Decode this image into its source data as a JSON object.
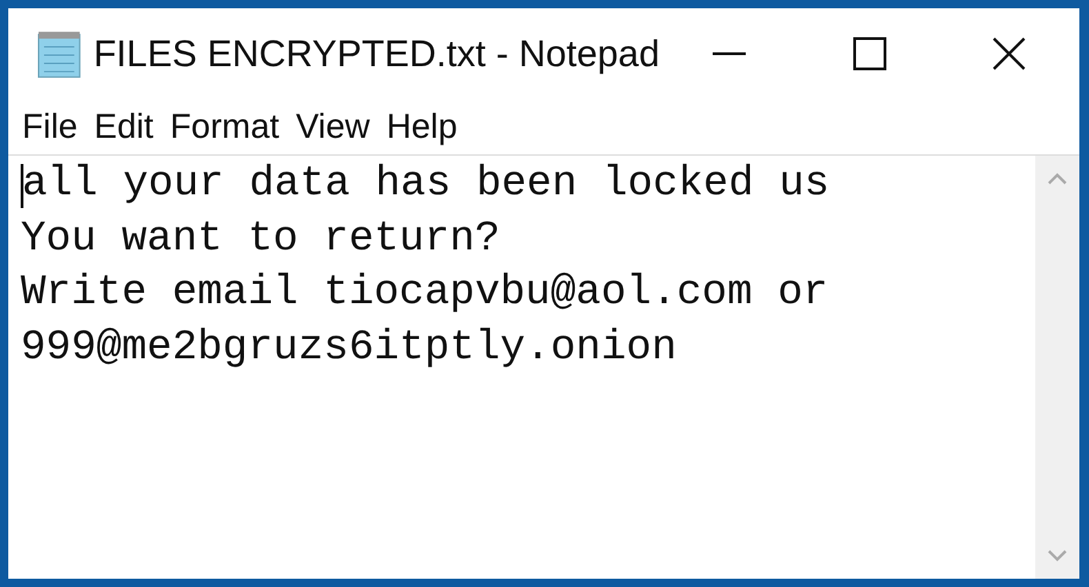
{
  "window": {
    "title": "FILES ENCRYPTED.txt - Notepad"
  },
  "menu": [
    {
      "label": "File"
    },
    {
      "label": "Edit"
    },
    {
      "label": "Format"
    },
    {
      "label": "View"
    },
    {
      "label": "Help"
    }
  ],
  "document": {
    "lines": [
      "all your data has been locked us",
      "You want to return?",
      "Write email tiocapvbu@aol.com or",
      "999@me2bgruzs6itptly.onion"
    ]
  }
}
